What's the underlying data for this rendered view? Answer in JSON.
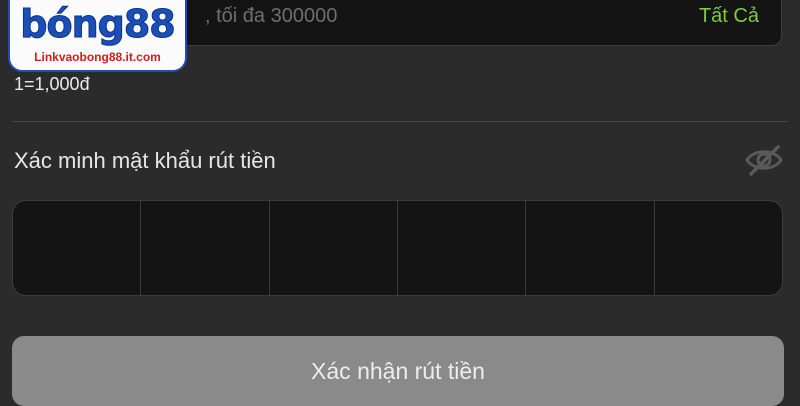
{
  "withdraw_form": {
    "amount_field": {
      "placeholder_visible": ", tối đa 300000",
      "all_label": "Tất Cả"
    },
    "exchange_rate": "1=1,000đ",
    "password_section": {
      "label": "Xác minh mật khẩu rút tiền",
      "visibility_icon": "eye-slash-icon",
      "pin_cells": 6
    },
    "confirm_button": "Xác nhận rút tiền"
  },
  "watermark": {
    "brand": "bóng88",
    "url": "Linkvaobong88.it.com"
  },
  "colors": {
    "background": "#2b2b2b",
    "field_background": "#141414",
    "accent_green": "#7dcc3a",
    "button_disabled": "#8a8a8a",
    "logo_blue": "#1a4fb8",
    "logo_red": "#d11c1c"
  }
}
